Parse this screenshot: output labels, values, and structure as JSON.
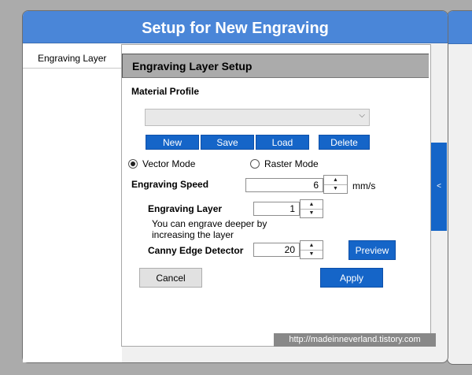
{
  "window": {
    "title": "Setup for New Engraving"
  },
  "sidebar": {
    "tabs": [
      {
        "label": "Engraving Layer"
      }
    ]
  },
  "section": {
    "title": "Engraving Layer Setup"
  },
  "material_profile": {
    "label": "Material Profile",
    "selected": "",
    "buttons": {
      "new": "New",
      "save": "Save",
      "load": "Load",
      "delete": "Delete"
    }
  },
  "mode": {
    "vector_label": "Vector Mode",
    "raster_label": "Raster Mode",
    "selected": "vector"
  },
  "speed": {
    "label": "Engraving Speed",
    "value": "6",
    "unit": "mm/s"
  },
  "layer": {
    "label": "Engraving Layer",
    "value": "1",
    "hint": "You can engrave deeper by increasing the layer"
  },
  "canny": {
    "label": "Canny Edge Detector",
    "value": "20",
    "preview_label": "Preview"
  },
  "actions": {
    "cancel": "Cancel",
    "apply": "Apply"
  },
  "collapse": {
    "glyph": "<"
  },
  "watermark": {
    "text": "http://madeinneverland.tistory.com"
  },
  "icons": {
    "dropdown": "chevron-down-icon",
    "spin_up": "triangle-up-icon",
    "spin_down": "triangle-down-icon"
  },
  "colors": {
    "title_bar": "#4a86d8",
    "accent_button": "#1565c8",
    "section_header": "#ababab",
    "background": "#ababab"
  }
}
